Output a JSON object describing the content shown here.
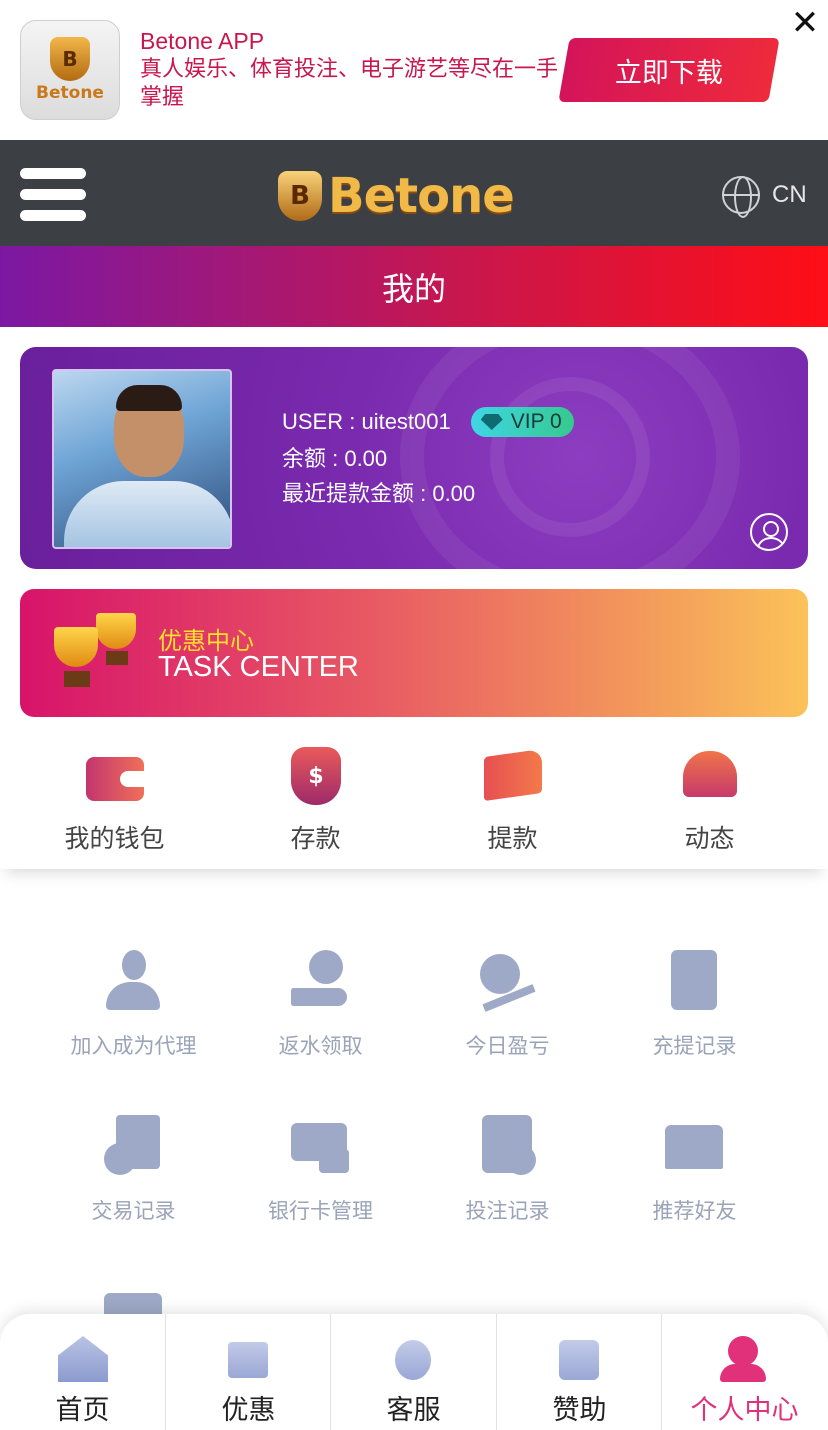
{
  "app_banner": {
    "title": "Betone APP",
    "description": "真人娱乐、体育投注、电子游艺等尽在一手掌握",
    "icon_text": "Betone",
    "download_label": "立即下载",
    "close_symbol": "✕"
  },
  "header": {
    "logo_text": "Betone",
    "language": "CN"
  },
  "page_title": "我的",
  "user_card": {
    "username": "USER : uitest001",
    "vip": "VIP 0",
    "balance": "余额 : 0.00",
    "recent_withdraw": "最近提款金额 : 0.00"
  },
  "task_center": {
    "title_cn": "优惠中心",
    "title_en": "TASK CENTER"
  },
  "quick_actions": [
    {
      "label": "我的钱包",
      "icon": "wallet-icon"
    },
    {
      "label": "存款",
      "icon": "money-bag-icon"
    },
    {
      "label": "提款",
      "icon": "withdraw-hand-icon"
    },
    {
      "label": "动态",
      "icon": "bell-icon"
    }
  ],
  "grid_menu": [
    {
      "label": "加入成为代理",
      "icon": "agent-icon"
    },
    {
      "label": "返水领取",
      "icon": "rebate-icon"
    },
    {
      "label": "今日盈亏",
      "icon": "profit-loss-icon"
    },
    {
      "label": "充提记录",
      "icon": "transfer-record-icon"
    },
    {
      "label": "交易记录",
      "icon": "transaction-record-icon"
    },
    {
      "label": "银行卡管理",
      "icon": "bank-card-icon"
    },
    {
      "label": "投注记录",
      "icon": "bet-record-icon"
    },
    {
      "label": "推荐好友",
      "icon": "refer-friends-icon"
    }
  ],
  "bottom_nav": [
    {
      "label": "首页",
      "icon": "home-icon"
    },
    {
      "label": "优惠",
      "icon": "gift-icon"
    },
    {
      "label": "客服",
      "icon": "customer-service-icon"
    },
    {
      "label": "赞助",
      "icon": "sponsor-icon"
    },
    {
      "label": "个人中心",
      "icon": "user-center-icon",
      "active": true
    }
  ],
  "colors": {
    "brand_pink": "#c8164f",
    "active_nav": "#e0317a",
    "header_bg": "#3c3f44",
    "muted_icon": "#9ea9c7"
  }
}
